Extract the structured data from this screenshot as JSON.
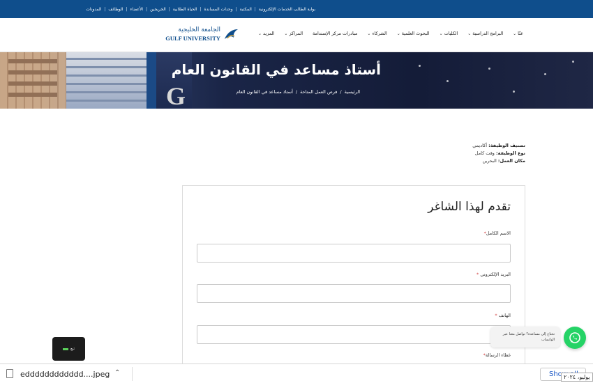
{
  "top_links": [
    "بوابة الطالب الخدمات الإلكترونية",
    "المكتبة",
    "وحدات المساندة",
    "الحياة الطلابية",
    "الخريجين",
    "الأعضاء",
    "الوظائف",
    "المدونات"
  ],
  "nav": {
    "items": [
      "عنّا",
      "البرامج الدراسية",
      "الكليات",
      "البحوث العلمية",
      "الشركاء",
      "مبادرات مركز الإستدامة",
      "المراكز",
      "المزيد"
    ],
    "has_dropdown": [
      true,
      true,
      true,
      true,
      true,
      false,
      true,
      true
    ]
  },
  "logo": {
    "arabic": "الجامعة الخليجية",
    "english": "GULF UNIVERSITY"
  },
  "hero": {
    "title": "أستاذ مساعد في القانون العام",
    "letter": "G",
    "breadcrumb": [
      "الرئيسية",
      "فرص العمل المتاحة",
      "أستاذ مساعد في القانون العام"
    ]
  },
  "details": [
    {
      "label": "تصنيف الوظيفة:",
      "value": "أكاديمي"
    },
    {
      "label": "نوع الوظيفة:",
      "value": "وقت كامل"
    },
    {
      "label": "مكان العمل:",
      "value": "البحرين"
    }
  ],
  "form": {
    "title": "تقدم لهذا الشاغر",
    "fields": [
      {
        "label": "الاسم الكامل",
        "required_mark": "*"
      },
      {
        "label": "البريد الإلكتروني",
        "required_mark": "*"
      },
      {
        "label": "الهاتف",
        "required_mark": "*"
      },
      {
        "label": "غطاء الرسالة",
        "required_mark": "*"
      }
    ]
  },
  "whatsapp": {
    "text": "تحتاج إلى مساعدة؟ تواصل معنا عبر الواتساب"
  },
  "dark_widget": {
    "label": "تبع"
  },
  "download_bar": {
    "filename": "edddddddddddd....jpeg",
    "show_all": "Show all",
    "date": "يوليو، ٢٠٢٤"
  },
  "colors": {
    "primary": "#0f4e8c",
    "whatsapp": "#25d366",
    "required": "#d13b3b"
  }
}
